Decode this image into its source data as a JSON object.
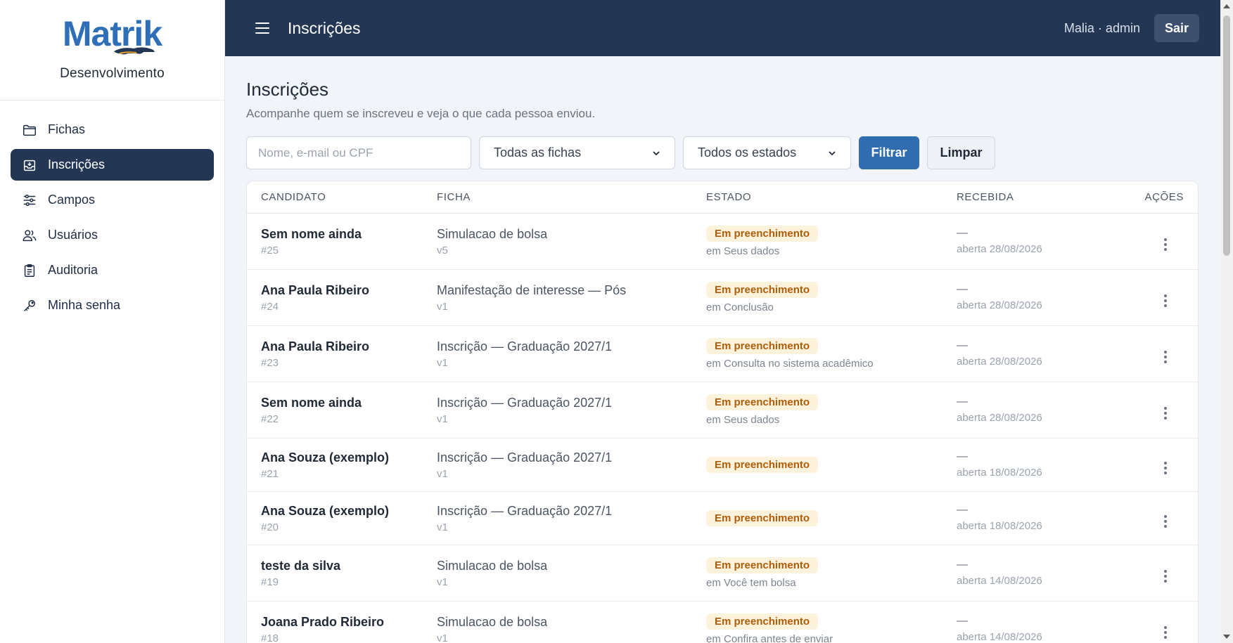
{
  "brand": {
    "logo_text": "Matrik",
    "environment": "Desenvolvimento"
  },
  "colors": {
    "navy": "#233755",
    "primary": "#2f6cb0",
    "badge_bg": "#fdf3dc",
    "badge_text": "#b05c08"
  },
  "nav": [
    {
      "label": "Fichas",
      "icon": "folder-icon",
      "active": false
    },
    {
      "label": "Inscrições",
      "icon": "inbox-icon",
      "active": true
    },
    {
      "label": "Campos",
      "icon": "sliders-icon",
      "active": false
    },
    {
      "label": "Usuários",
      "icon": "users-icon",
      "active": false
    },
    {
      "label": "Auditoria",
      "icon": "clipboard-icon",
      "active": false
    },
    {
      "label": "Minha senha",
      "icon": "key-icon",
      "active": false
    }
  ],
  "topbar": {
    "title": "Inscrições",
    "user": "Malia · admin",
    "logout_label": "Sair"
  },
  "page": {
    "title": "Inscrições",
    "subtitle": "Acompanhe quem se inscreveu e veja o que cada pessoa enviou."
  },
  "filters": {
    "search_placeholder": "Nome, e-mail ou CPF",
    "ficha_selected": "Todas as fichas",
    "estado_selected": "Todos os estados",
    "filter_label": "Filtrar",
    "clear_label": "Limpar"
  },
  "table": {
    "headers": [
      "CANDIDATO",
      "FICHA",
      "ESTADO",
      "RECEBIDA",
      "AÇÕES"
    ],
    "rows": [
      {
        "name": "Sem nome ainda",
        "id": "#25",
        "ficha": "Simulacao de bolsa",
        "version": "v5",
        "status": "Em preenchimento",
        "status_sub": "em Seus dados",
        "received": "—",
        "opened": "aberta 28/08/2026"
      },
      {
        "name": "Ana Paula Ribeiro",
        "id": "#24",
        "ficha": "Manifestação de interesse — Pós",
        "version": "v1",
        "status": "Em preenchimento",
        "status_sub": "em Conclusão",
        "received": "—",
        "opened": "aberta 28/08/2026"
      },
      {
        "name": "Ana Paula Ribeiro",
        "id": "#23",
        "ficha": "Inscrição — Graduação 2027/1",
        "version": "v1",
        "status": "Em preenchimento",
        "status_sub": "em Consulta no sistema acadêmico",
        "received": "—",
        "opened": "aberta 28/08/2026"
      },
      {
        "name": "Sem nome ainda",
        "id": "#22",
        "ficha": "Inscrição — Graduação 2027/1",
        "version": "v1",
        "status": "Em preenchimento",
        "status_sub": "em Seus dados",
        "received": "—",
        "opened": "aberta 28/08/2026"
      },
      {
        "name": "Ana Souza (exemplo)",
        "id": "#21",
        "ficha": "Inscrição — Graduação 2027/1",
        "version": "v1",
        "status": "Em preenchimento",
        "status_sub": "",
        "received": "—",
        "opened": "aberta 18/08/2026"
      },
      {
        "name": "Ana Souza (exemplo)",
        "id": "#20",
        "ficha": "Inscrição — Graduação 2027/1",
        "version": "v1",
        "status": "Em preenchimento",
        "status_sub": "",
        "received": "—",
        "opened": "aberta 18/08/2026"
      },
      {
        "name": "teste da silva",
        "id": "#19",
        "ficha": "Simulacao de bolsa",
        "version": "v1",
        "status": "Em preenchimento",
        "status_sub": "em Você tem bolsa",
        "received": "—",
        "opened": "aberta 14/08/2026"
      },
      {
        "name": "Joana Prado Ribeiro",
        "id": "#18",
        "ficha": "Simulacao de bolsa",
        "version": "v1",
        "status": "Em preenchimento",
        "status_sub": "em Confira antes de enviar",
        "received": "—",
        "opened": "aberta 14/08/2026"
      }
    ]
  }
}
